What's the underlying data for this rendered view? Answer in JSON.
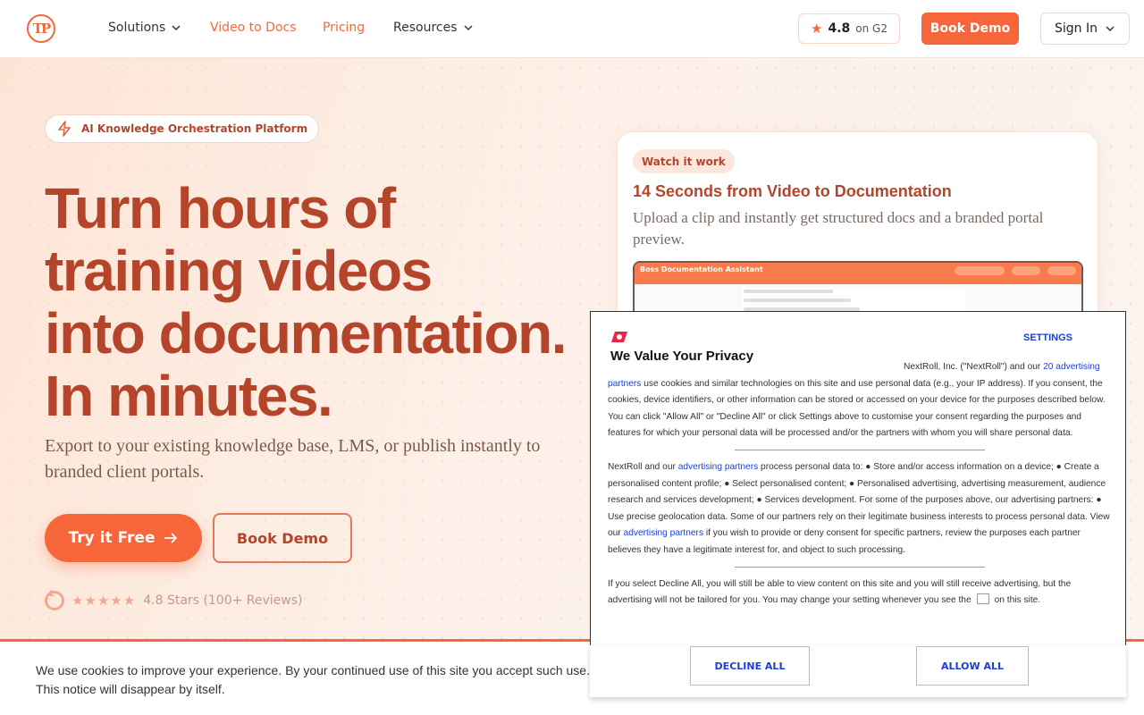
{
  "header": {
    "logo": "TP",
    "nav": [
      {
        "label": "Solutions"
      },
      {
        "label": "Video to Docs"
      },
      {
        "label": "Pricing"
      },
      {
        "label": "Resources"
      }
    ],
    "g2_rating": "4.8",
    "g2_suffix": "on G2",
    "book_demo": "Book Demo",
    "sign_in": "Sign In"
  },
  "hero": {
    "pill": "AI Knowledge Orchestration Platform",
    "headline": [
      "Turn hours of",
      "training videos",
      "into documentation.",
      "In minutes."
    ],
    "subline": "Export to your existing knowledge base, LMS, or publish instantly to branded client portals.",
    "cta_primary": "Try it Free",
    "cta_secondary": "Book Demo",
    "reviews": "4.8 Stars (100+ Reviews)",
    "review_stars": 5
  },
  "card": {
    "tag": "Watch it work",
    "title": "14 Seconds from Video to Documentation",
    "description": "Upload a clip and instantly get structured docs and a branded portal preview.",
    "preview_title": "Boss Documentation Assistant"
  },
  "cookie_bar": {
    "line1": "We use cookies to improve your experience. By your continued use of this site you accept such use.",
    "line2": "This notice will disappear by itself."
  },
  "privacy": {
    "settings": "SETTINGS",
    "title": "We Value Your Privacy",
    "p1_a": "NextRoll, Inc. (\"NextRoll\") and our ",
    "p1_link": "20 advertising partners",
    "p1_b": " use cookies and similar technologies on this site and use personal data (e.g., your IP address). If you consent, the cookies, device identifiers, or other information can be stored or accessed on your device for the purposes described below. You can click \"Allow All\" or \"Decline All\" or click Settings above to customise your consent regarding the purposes and features for which your personal data will be processed and/or the partners with whom you will share personal data.",
    "p2_a": "NextRoll and our ",
    "p2_link1": "advertising partners",
    "p2_b": " process personal data to: ● Store and/or access information on a device; ● Create a personalised content profile; ● Select personalised content; ● Personalised advertising, advertising measurement, audience research and services development; ● Services development. For some of the purposes above, our advertising partners: ● Use precise geolocation data. Some of our partners rely on their legitimate business interests to process personal data. View our ",
    "p2_link2": "advertising partners",
    "p2_c": " if you wish to provide or deny consent for specific partners, review the purposes each partner believes they have a legitimate interest for, and object to such processing.",
    "p3_a": "If you select Decline All, you will still be able to view content on this site and you will still receive advertising, but the advertising will not be tailored for you. You may change your setting whenever you see the",
    "p3_b": "on this site.",
    "decline": "DECLINE ALL",
    "allow": "ALLOW ALL"
  },
  "colors": {
    "accent": "#f7653a",
    "headline": "#b4452b",
    "link": "#1a3fd6"
  }
}
